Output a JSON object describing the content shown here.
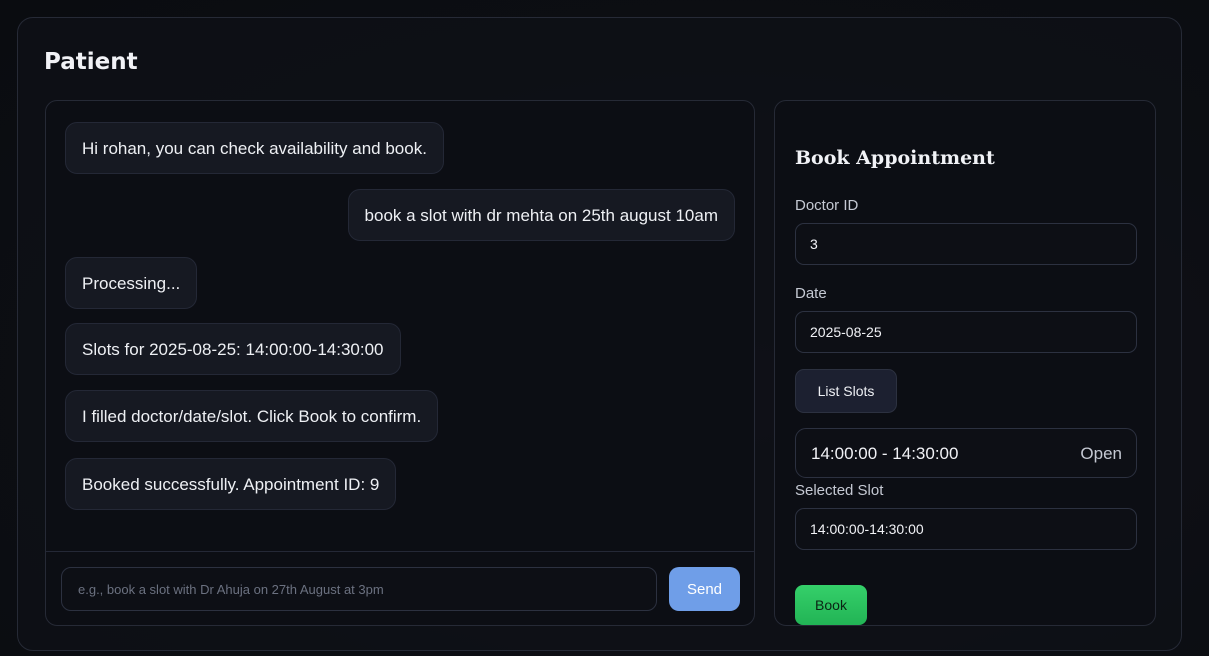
{
  "panel": {
    "title": "Patient"
  },
  "chat": {
    "messages": [
      {
        "role": "assistant",
        "text": "Hi rohan, you can check availability and book."
      },
      {
        "role": "user",
        "text": "book a slot with dr mehta on 25th august 10am"
      },
      {
        "role": "assistant",
        "text": "Processing..."
      },
      {
        "role": "assistant",
        "text": "Slots for 2025-08-25: 14:00:00-14:30:00"
      },
      {
        "role": "assistant",
        "text": "I filled doctor/date/slot. Click Book to confirm."
      },
      {
        "role": "assistant",
        "text": "Booked successfully. Appointment ID: 9"
      }
    ],
    "input": {
      "value": "",
      "placeholder": "e.g., book a slot with Dr Ahuja on 27th August at 3pm"
    },
    "send_label": "Send"
  },
  "booking": {
    "title": "Book Appointment",
    "doctor_id": {
      "label": "Doctor ID",
      "value": "3"
    },
    "date": {
      "label": "Date",
      "value": "2025-08-25"
    },
    "list_slots_label": "List Slots",
    "slots": [
      {
        "time": "14:00:00 - 14:30:00",
        "status": "Open"
      }
    ],
    "selected_slot": {
      "label": "Selected Slot",
      "value": "14:00:00-14:30:00"
    },
    "book_label": "Book"
  },
  "colors": {
    "send_button": "#6f9ee8",
    "book_button": "#2ec463",
    "background": "#0b0d12"
  }
}
